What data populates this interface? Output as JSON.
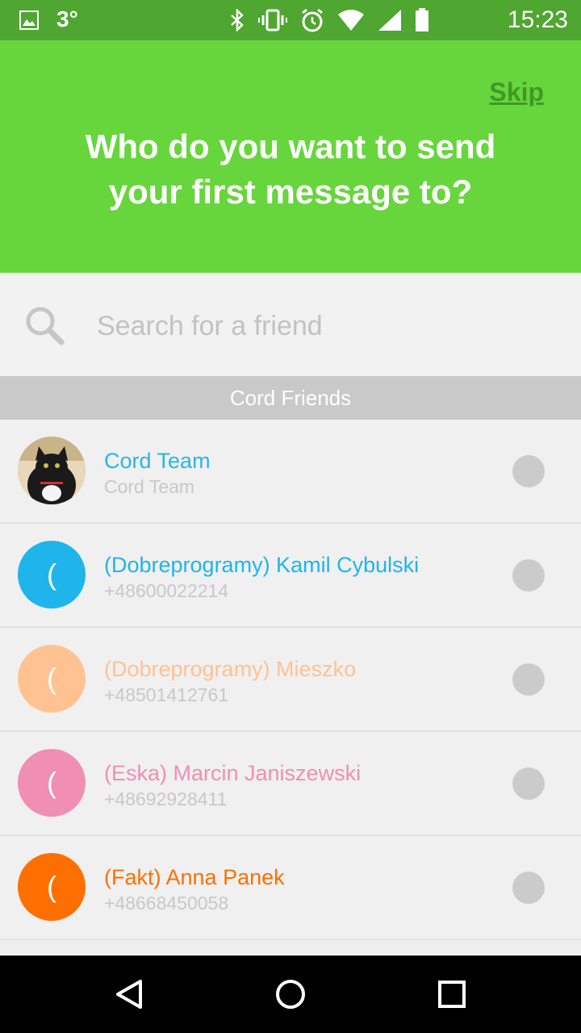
{
  "status_bar": {
    "temperature": "3°",
    "time": "15:23",
    "icons": [
      "gallery-icon",
      "bluetooth-icon",
      "vibrate-icon",
      "alarm-icon",
      "wifi-icon",
      "signal-icon",
      "battery-icon"
    ]
  },
  "header": {
    "skip_label": "Skip",
    "title_line1": "Who do you want to send",
    "title_line2": "your first message to?"
  },
  "search": {
    "placeholder": "Search for a friend",
    "value": ""
  },
  "section": {
    "title": "Cord Friends"
  },
  "contacts": [
    {
      "name": "Cord Team",
      "sub": "Cord Team",
      "color": "#29b6e8",
      "avatar": "photo",
      "avatar_glyph": ""
    },
    {
      "name": "(Dobreprogramy) Kamil Cybulski",
      "sub": "+48600022214",
      "color": "#1fb5ea",
      "avatar": "letter",
      "avatar_glyph": "("
    },
    {
      "name": "(Dobreprogramy) Mieszko",
      "sub": "+48501412761",
      "color": "#ffc290",
      "avatar": "letter",
      "avatar_glyph": "("
    },
    {
      "name": "(Eska) Marcin Janiszewski",
      "sub": "+48692928411",
      "color": "#f08fb2",
      "avatar": "letter",
      "avatar_glyph": "("
    },
    {
      "name": "(Fakt) Anna Panek",
      "sub": "+48668450058",
      "color": "#ff6f00",
      "avatar": "letter",
      "avatar_glyph": "("
    }
  ],
  "nav": {
    "icons": [
      "back-icon",
      "home-icon",
      "recents-icon"
    ]
  },
  "colors": {
    "status_bar": "#4fa631",
    "header": "#66d63c",
    "skip": "#3f9a24"
  }
}
